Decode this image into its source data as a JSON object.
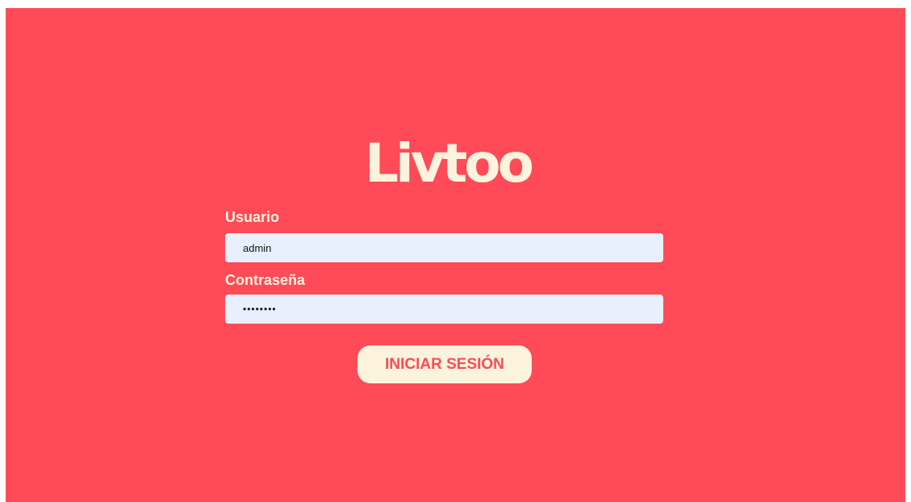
{
  "login": {
    "logo_text": "Livtoo",
    "username_label": "Usuario",
    "username_value": "admin",
    "password_label": "Contraseña",
    "password_value": "••••••••",
    "submit_label": "INICIAR SESIÓN"
  },
  "colors": {
    "background": "#ff4a57",
    "accent_text": "#fcf3dd",
    "input_background": "#e8f0fe",
    "button_text": "#ff4a57"
  }
}
